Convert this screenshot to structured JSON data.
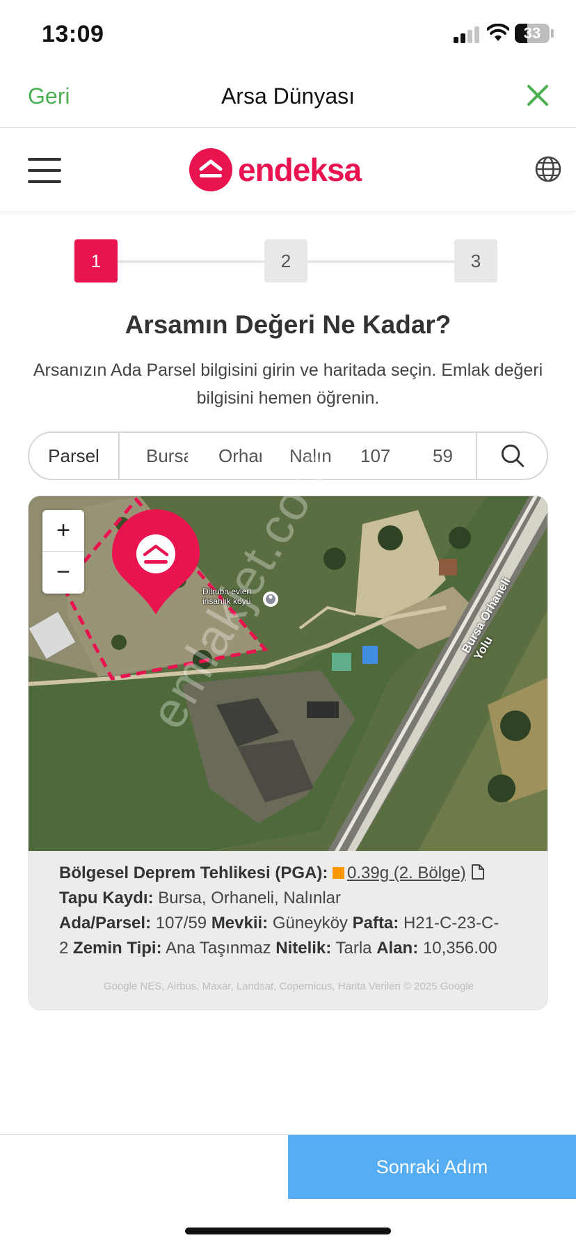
{
  "status_bar": {
    "time": "13:09",
    "battery": "33"
  },
  "nav": {
    "back_label": "Geri",
    "title": "Arsa Dünyası"
  },
  "brand": {
    "name": "endeksa",
    "color": "#e8134f"
  },
  "stepper": {
    "steps": [
      "1",
      "2",
      "3"
    ],
    "active_step": "1"
  },
  "headline": "Arsamın Değeri Ne Kadar?",
  "subtext": "Arsanızın Ada Parsel bilgisini girin ve haritada seçin. Emlak değeri bilgisini hemen öğrenin.",
  "search": {
    "mode_tab": "Parsel",
    "segments": [
      "Bursa",
      "Orhaneli",
      "Nalınlar",
      "107",
      "59"
    ]
  },
  "map": {
    "poi_label_line1": "Dilruba evleri",
    "poi_label_line2": "insanlık köyü",
    "road_label": "Bursa Orhaneli Yolu",
    "zoom_in": "+",
    "zoom_out": "−",
    "attribution": "Google  NES, Airbus, Maxar, Landsat, Copernicus, Harita Verileri © 2025 Google"
  },
  "info": {
    "pga_label": "Bölgesel Deprem Tehlikesi (PGA):",
    "pga_value": "0.39g (2. Bölge)",
    "pga_color": "#ff9800",
    "tapu_label": "Tapu Kaydı:",
    "tapu_value": "Bursa, Orhaneli, Nalınlar",
    "ada_label": "Ada/Parsel:",
    "ada_value": "107/59",
    "mevki_label": "Mevkii:",
    "mevki_value": "Güneyköy",
    "pafta_label": "Pafta:",
    "pafta_value": "H21-C-23-C-2",
    "zemin_label": "Zemin Tipi:",
    "zemin_value": "Ana Taşınmaz",
    "nitelik_label": "Nitelik:",
    "nitelik_value": "Tarla",
    "alan_label": "Alan:",
    "alan_value": "10,356.00"
  },
  "watermark": "emlakjet.com",
  "footer": {
    "next_label": "Sonraki Adım",
    "next_color": "#55adf3"
  },
  "icons": [
    "signal-icon",
    "wifi-icon",
    "battery-icon",
    "close-icon",
    "menu-icon",
    "globe-icon",
    "search-icon",
    "map-pin-icon",
    "document-icon"
  ]
}
